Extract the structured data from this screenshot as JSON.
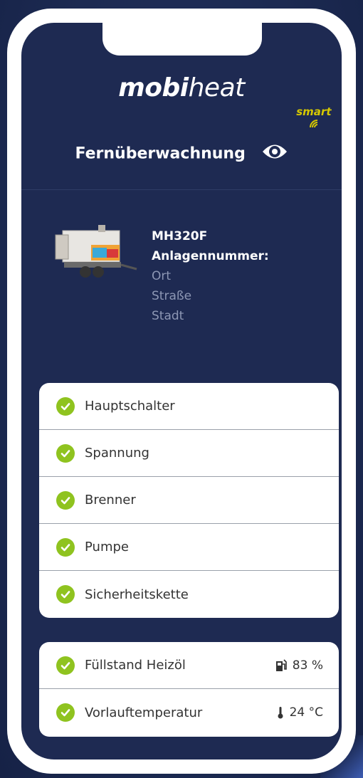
{
  "app": {
    "logo_main": "mobi",
    "logo_light": "heat",
    "logo_sub": "smart",
    "title": "Fernüberwachnung"
  },
  "device": {
    "model": "MH320F",
    "plant_number_label": "Anlagennummer:",
    "location_label": "Ort",
    "street_label": "Straße",
    "city_label": "Stadt"
  },
  "status_checks": [
    {
      "label": "Hauptschalter",
      "status": "ok"
    },
    {
      "label": "Spannung",
      "status": "ok"
    },
    {
      "label": "Brenner",
      "status": "ok"
    },
    {
      "label": "Pumpe",
      "status": "ok"
    },
    {
      "label": "Sicherheitskette",
      "status": "ok"
    }
  ],
  "measurements": [
    {
      "label": "Füllstand Heizöl",
      "value": "83 %",
      "icon": "fuel-pump-icon",
      "status": "ok"
    },
    {
      "label": "Vorlauftemperatur",
      "value": "24 °C",
      "icon": "thermometer-icon",
      "status": "ok"
    }
  ],
  "colors": {
    "screen_bg": "#1e2a52",
    "check_green": "#8fc31f",
    "logo_yellow": "#d6c800"
  }
}
